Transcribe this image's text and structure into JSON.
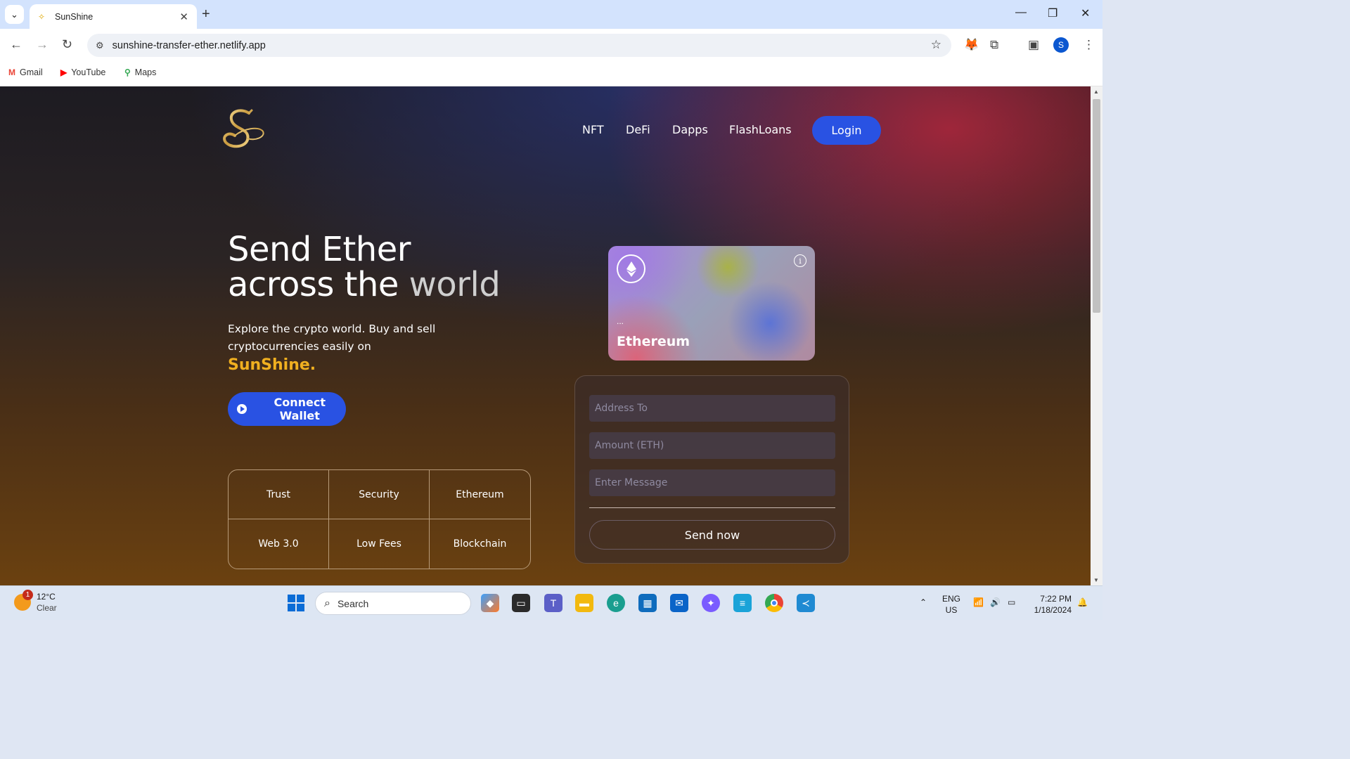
{
  "browser": {
    "tab_title": "SunShine",
    "url": "sunshine-transfer-ether.netlify.app",
    "bookmarks": [
      "Gmail",
      "YouTube",
      "Maps"
    ],
    "profile_initial": "S"
  },
  "page": {
    "nav": [
      "NFT",
      "DeFi",
      "Dapps",
      "FlashLoans"
    ],
    "login_label": "Login",
    "hero_line1": "Send Ether",
    "hero_line2_a": "across the ",
    "hero_line2_b": "world",
    "hero_sub": "Explore the crypto world. Buy and sell cryptocurrencies easily on",
    "brand": "SunShine.",
    "connect_label": "Connect Wallet",
    "features": [
      "Trust",
      "Security",
      "Ethereum",
      "Web 3.0",
      "Low Fees",
      "Blockchain"
    ],
    "card": {
      "address": "...",
      "network": "Ethereum"
    },
    "form": {
      "address_placeholder": "Address To",
      "amount_placeholder": "Amount (ETH)",
      "message_placeholder": "Enter Message",
      "send_label": "Send now"
    },
    "colors": {
      "accent_blue": "#2952e3",
      "brand_gold": "#f0b020"
    }
  },
  "taskbar": {
    "weather_temp": "12°C",
    "weather_desc": "Clear",
    "weather_badge": "1",
    "search_label": "Search",
    "lang_line1": "ENG",
    "lang_line2": "US",
    "time": "7:22 PM",
    "date": "1/18/2024"
  }
}
